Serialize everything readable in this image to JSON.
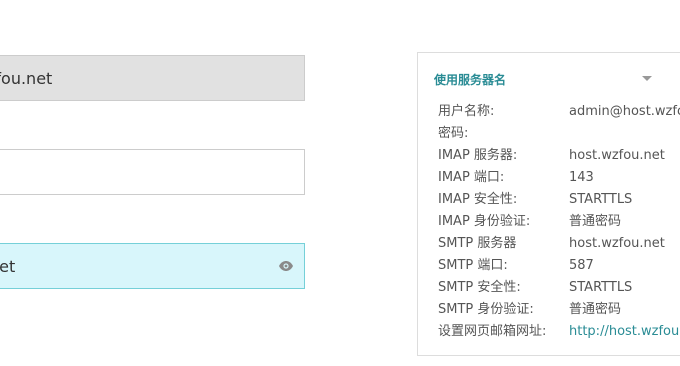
{
  "form": {
    "field1_value": "zfou.net",
    "field2_value": "",
    "field3_value": "net"
  },
  "panel": {
    "header": "使用服务器名",
    "rows": [
      {
        "label": "用户名称:",
        "value": "admin@host.wzfo"
      },
      {
        "label": "密码:",
        "value": ""
      },
      {
        "label": "IMAP 服务器:",
        "value": "host.wzfou.net"
      },
      {
        "label": "IMAP 端口:",
        "value": "143"
      },
      {
        "label": "IMAP 安全性:",
        "value": "STARTTLS"
      },
      {
        "label": "IMAP 身份验证:",
        "value": "普通密码"
      },
      {
        "label": "SMTP 服务器",
        "value": "host.wzfou.net"
      },
      {
        "label": "SMTP 端口:",
        "value": "587"
      },
      {
        "label": "SMTP 安全性:",
        "value": "STARTTLS"
      },
      {
        "label": "SMTP 身份验证:",
        "value": "普通密码"
      },
      {
        "label": "设置网页邮箱网址:",
        "value": "http://host.wzfou.n"
      }
    ]
  },
  "icons": {
    "eye": "eye-icon",
    "caret": "caret-down-icon"
  },
  "colors": {
    "accent": "#2a8c95",
    "focus_bg": "#d8f6fb",
    "focus_border": "#75d0d8",
    "disabled_bg": "#e1e1e1"
  }
}
